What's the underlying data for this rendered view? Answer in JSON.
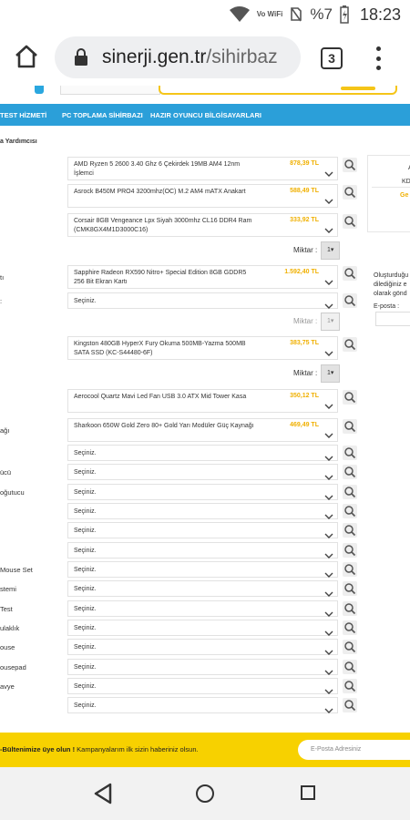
{
  "status_bar": {
    "signal_icon": "wifi-signal-icon",
    "volte_badge": "Vo WiFi",
    "battery_percent": "%7",
    "time": "18:23"
  },
  "browser": {
    "url_host": "sinerji.gen.tr",
    "url_path": "/sihirbaz",
    "tab_count": "3"
  },
  "nav": {
    "items": [
      "TEST HİZMETİ",
      "PC TOPLAMA SİHİRBAZI",
      "HAZIR OYUNCU BİLGİSAYARLARI"
    ]
  },
  "section_title": "a Yardımcısı",
  "rows": [
    {
      "label": "",
      "text": "AMD Ryzen 5 2600 3.40 Ghz 6 Çekirdek 19MB AM4 12nm İşlemci",
      "price": "878,39 TL"
    },
    {
      "label": "",
      "text": "Asrock B450M PRO4 3200mhz(OC) M.2 AM4 mATX Anakart",
      "price": "588,49 TL"
    },
    {
      "label": "",
      "text": "Corsair 8GB Vengeance Lpx Siyah 3000mhz CL16 DDR4 Ram (CMK8GX4M1D3000C16)",
      "price": "333,92 TL"
    },
    {
      "label": "tı",
      "text": "Sapphire Radeon RX590 Nitro+ Special Edition 8GB GDDR5 256 Bit Ekran Kartı",
      "price": "1.592,40 TL"
    },
    {
      "label": ":",
      "text": "Seçiniz.",
      "price": ""
    },
    {
      "label": "",
      "text": "Kingston 480GB HyperX Fury Okuma 500MB-Yazma 500MB SATA SSD (KC-S44480-6F)",
      "price": "383,75 TL"
    },
    {
      "label": "",
      "text": "Aerocool Quartz Mavi Led Fan USB 3.0 ATX Mid Tower Kasa",
      "price": "350,12 TL"
    },
    {
      "label": "ağı",
      "text": "Sharkoon 650W Gold Zero 80+ Gold Yarı Modüler Güç Kaynağı",
      "price": "469,49 TL"
    },
    {
      "label": "",
      "text": "Seçiniz.",
      "price": ""
    },
    {
      "label": "ücü",
      "text": "Seçiniz.",
      "price": ""
    },
    {
      "label": "oğutucu",
      "text": "Seçiniz.",
      "price": ""
    },
    {
      "label": "",
      "text": "Seçiniz.",
      "price": ""
    },
    {
      "label": "",
      "text": "Seçiniz.",
      "price": ""
    },
    {
      "label": "",
      "text": "Seçiniz.",
      "price": ""
    },
    {
      "label": "Mouse Set",
      "text": "Seçiniz.",
      "price": ""
    },
    {
      "label": "stemi",
      "text": "Seçiniz.",
      "price": ""
    },
    {
      "label": "Test",
      "text": "Seçiniz.",
      "price": ""
    },
    {
      "label": "ulaklık",
      "text": "Seçiniz.",
      "price": ""
    },
    {
      "label": "ouse",
      "text": "Seçiniz.",
      "price": ""
    },
    {
      "label": "ousepad",
      "text": "Seçiniz.",
      "price": ""
    },
    {
      "label": "avye",
      "text": "Seçiniz.",
      "price": ""
    },
    {
      "label": "",
      "text": "Seçiniz.",
      "price": ""
    }
  ],
  "miktar": [
    {
      "label": "Miktar :",
      "value": "1"
    },
    {
      "label": "Miktar :",
      "value": "1"
    },
    {
      "label": "Miktar :",
      "value": "1"
    }
  ],
  "side": {
    "a": "A",
    "kd": "KD",
    "ge": "Ge",
    "info": [
      "Oluşturduğu",
      "dilediğiniz e",
      "olarak gönd"
    ],
    "email_label": "E-posta :"
  },
  "footer": {
    "bold": "-Bültenimize üye olun !",
    "text": " Kampanyalarım ilk sizin haberiniz olsun.",
    "email_placeholder": "E-Posta Adresiniz"
  },
  "colors": {
    "nav_blue": "#2b9fd9",
    "price_yellow": "#f0b000",
    "footer_yellow": "#f7d100"
  }
}
